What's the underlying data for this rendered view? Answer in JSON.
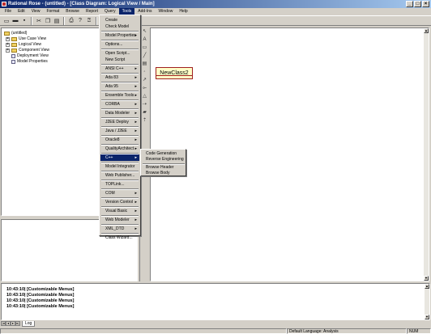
{
  "title": "Rational Rose - (untitled) - [Class Diagram: Logical View / Main]",
  "window_controls": [
    "_",
    "□",
    "×"
  ],
  "menubar": [
    "File",
    "Edit",
    "View",
    "Format",
    "Browse",
    "Report",
    "Query",
    "Tools",
    "Add-Ins",
    "Window",
    "Help"
  ],
  "active_menu": "Tools",
  "browser_tree": [
    {
      "label": "(untitled)",
      "level": 0,
      "expander": "",
      "icon": "folder"
    },
    {
      "label": "Use Case View",
      "level": 1,
      "expander": "+",
      "icon": "folder"
    },
    {
      "label": "Logical View",
      "level": 1,
      "expander": "+",
      "icon": "folder"
    },
    {
      "label": "Component View",
      "level": 1,
      "expander": "+",
      "icon": "folder"
    },
    {
      "label": "Deployment View",
      "level": 1,
      "expander": "",
      "icon": "doc"
    },
    {
      "label": "Model Properties",
      "level": 1,
      "expander": "",
      "icon": "doc"
    }
  ],
  "diagram": {
    "class_name": "NewClass2"
  },
  "tools_menu": {
    "items": [
      {
        "label": "Create",
        "submenu": false
      },
      {
        "label": "Check Model",
        "submenu": false
      },
      {
        "sep": true
      },
      {
        "label": "Model Properties",
        "submenu": true
      },
      {
        "sep": true
      },
      {
        "label": "Options...",
        "submenu": false
      },
      {
        "sep": true
      },
      {
        "label": "Open Script...",
        "submenu": false
      },
      {
        "label": "New Script",
        "submenu": false
      },
      {
        "sep": true
      },
      {
        "label": "ANSI C++",
        "submenu": true
      },
      {
        "sep": true
      },
      {
        "label": "Ada 83",
        "submenu": true
      },
      {
        "sep": true
      },
      {
        "label": "Ada 95",
        "submenu": true
      },
      {
        "sep": true
      },
      {
        "label": "Ensemble Tools",
        "submenu": true
      },
      {
        "sep": true
      },
      {
        "label": "CORBA",
        "submenu": true
      },
      {
        "sep": true
      },
      {
        "label": "Data Modeler",
        "submenu": true
      },
      {
        "sep": true
      },
      {
        "label": "J2EE Deploy",
        "submenu": true
      },
      {
        "sep": true
      },
      {
        "label": "Java / J2EE",
        "submenu": true
      },
      {
        "sep": true
      },
      {
        "label": "Oracle8",
        "submenu": true
      },
      {
        "sep": true
      },
      {
        "label": "QualityArchitect",
        "submenu": true
      },
      {
        "sep": true
      },
      {
        "label": "C++",
        "submenu": true,
        "highlight": true
      },
      {
        "sep": true
      },
      {
        "label": "Model Integrator",
        "submenu": false
      },
      {
        "sep": true
      },
      {
        "label": "Web Publisher...",
        "submenu": false
      },
      {
        "sep": true
      },
      {
        "label": "TOPLink...",
        "submenu": false
      },
      {
        "sep": true
      },
      {
        "label": "COM",
        "submenu": true
      },
      {
        "sep": true
      },
      {
        "label": "Version Control",
        "submenu": true
      },
      {
        "sep": true
      },
      {
        "label": "Visual Basic",
        "submenu": true
      },
      {
        "sep": true
      },
      {
        "label": "Web Modeler",
        "submenu": true
      },
      {
        "sep": true
      },
      {
        "label": "XML_DTD",
        "submenu": true
      },
      {
        "sep": true
      },
      {
        "label": "Class Wizard...",
        "submenu": false
      }
    ]
  },
  "cpp_submenu": {
    "items": [
      {
        "label": "Code Generation"
      },
      {
        "label": "Reverse Engineering"
      },
      {
        "sep": true
      },
      {
        "label": "Browse Header"
      },
      {
        "label": "Browse Body"
      }
    ]
  },
  "log": {
    "lines": [
      "10:43:10|  [Customizable Menus]",
      "10:43:10|  [Customizable Menus]",
      "10:43:10|  [Customizable Menus]",
      "10:43:10|  [Customizable Menus]"
    ],
    "tab": "Log"
  },
  "status": {
    "language": "Default Language: Analysis",
    "num": "NUM"
  }
}
